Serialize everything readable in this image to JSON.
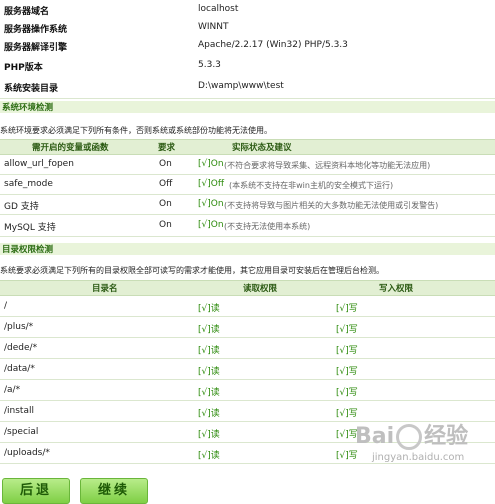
{
  "server_info": [
    {
      "label": "服务器域名",
      "value": "localhost"
    },
    {
      "label": "服务器操作系统",
      "value": "WINNT"
    },
    {
      "label": "服务器解译引擎",
      "value": "Apache/2.2.17 (Win32) PHP/5.3.3"
    },
    {
      "label": "PHP版本",
      "value": "5.3.3"
    },
    {
      "label": "系统安装目录",
      "value": "D:\\wamp\\www\\test"
    }
  ],
  "env_check": {
    "title": "系统环境检测",
    "desc": "系统环境要求必须满足下列所有条件，否则系统或系统部份功能将无法使用。",
    "headers": [
      "需开启的变量或函数",
      "要求",
      "实际状态及建议"
    ],
    "rows": [
      {
        "name": "allow_url_fopen",
        "req": "On",
        "status": "[√]On",
        "note": "(不符合要求将导致采集、远程资料本地化等功能无法应用)"
      },
      {
        "name": "safe_mode",
        "req": "Off",
        "status": "[√]Off",
        "note": "(本系统不支持在非win主机的安全模式下运行)"
      },
      {
        "name": "GD 支持",
        "req": "On",
        "status": "[√]On",
        "note": "(不支持将导致与图片相关的大多数功能无法使用或引发警告)"
      },
      {
        "name": "MySQL 支持",
        "req": "On",
        "status": "[√]On",
        "note": "(不支持无法使用本系统)"
      }
    ]
  },
  "dir_check": {
    "title": "目录权限检测",
    "desc": "系统要求必须满足下列所有的目录权限全部可读写的需求才能使用，其它应用目录可安装后在管理后台检测。",
    "headers": [
      "目录名",
      "读取权限",
      "写入权限"
    ],
    "rows": [
      {
        "dir": "/",
        "read": "[√]读",
        "write": "[√]写"
      },
      {
        "dir": "/plus/*",
        "read": "[√]读",
        "write": "[√]写"
      },
      {
        "dir": "/dede/*",
        "read": "[√]读",
        "write": "[√]写"
      },
      {
        "dir": "/data/*",
        "read": "[√]读",
        "write": "[√]写"
      },
      {
        "dir": "/a/*",
        "read": "[√]读",
        "write": "[√]写"
      },
      {
        "dir": "/install",
        "read": "[√]读",
        "write": "[√]写"
      },
      {
        "dir": "/special",
        "read": "[√]读",
        "write": "[√]写"
      },
      {
        "dir": "/uploads/*",
        "read": "[√]读",
        "write": "[√]写"
      }
    ]
  },
  "buttons": {
    "back": "后退",
    "next": "继续"
  },
  "watermark": {
    "brand": "Bai",
    "brand2": "经验",
    "url": "jingyan.baidu.com"
  }
}
